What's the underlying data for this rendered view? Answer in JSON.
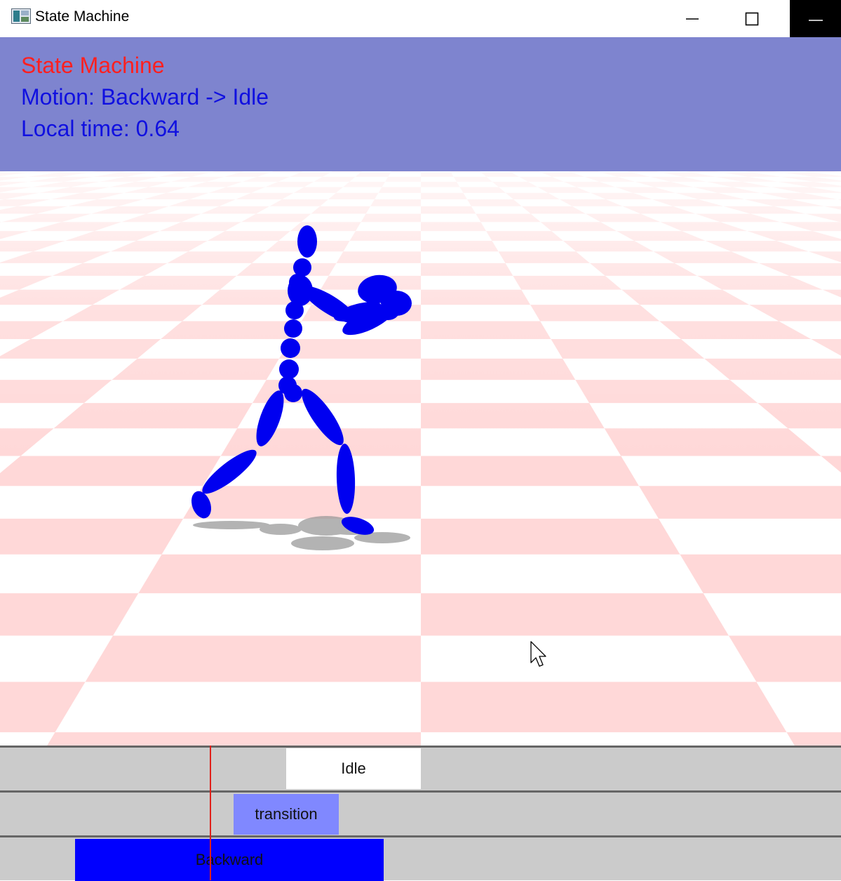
{
  "window": {
    "title": "State Machine",
    "icon": "app-window-icon",
    "controls": [
      "minimize-icon",
      "maximize-icon",
      "close-icon"
    ]
  },
  "hud": {
    "title": "State Machine",
    "motion": "Motion: Backward -> Idle",
    "local_time": "Local time: 0.64",
    "title_color": "#ff2020",
    "text_color": "#1010e0",
    "background": "#7e84cf"
  },
  "scene": {
    "character_color": "#0000ff",
    "floor_colors": [
      "#ffffff",
      "#ffd8d8"
    ]
  },
  "timeline": {
    "tracks": [
      {
        "label": "Idle",
        "color": "#ffffff"
      },
      {
        "label": "transition",
        "color": "#8088ff"
      },
      {
        "label": "Backward",
        "color": "#0000ff"
      }
    ],
    "playhead_color": "#e0201a"
  }
}
